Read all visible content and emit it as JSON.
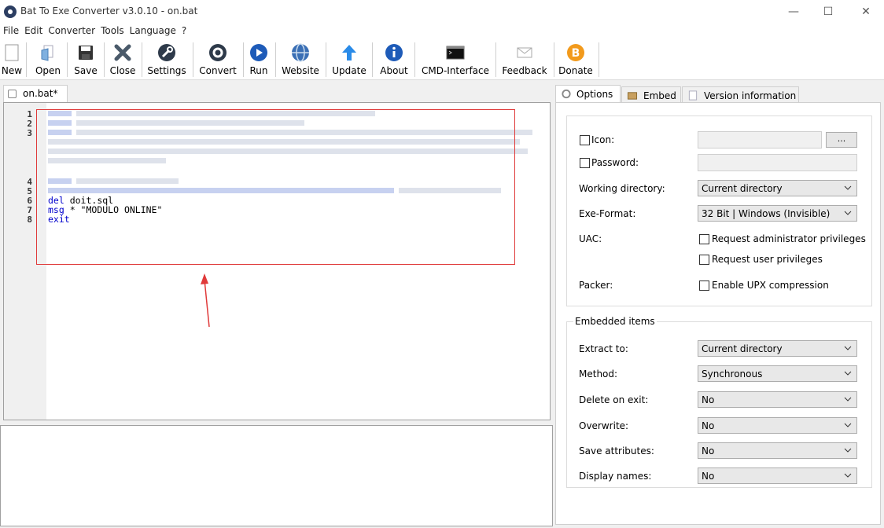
{
  "window": {
    "title": "Bat To Exe Converter v3.0.10 - on.bat",
    "minimize": "—",
    "maximize": "☐",
    "close": "✕"
  },
  "menu": [
    "File",
    "Edit",
    "Converter",
    "Tools",
    "Language",
    "?"
  ],
  "toolbar": [
    {
      "label": "New",
      "icon": "new-file-icon"
    },
    {
      "label": "Open",
      "icon": "open-folder-icon"
    },
    {
      "label": "Save",
      "icon": "floppy-disk-icon"
    },
    {
      "label": "Close",
      "icon": "close-x-icon"
    },
    {
      "label": "Settings",
      "icon": "wrench-icon"
    },
    {
      "label": "Convert",
      "icon": "gear-icon"
    },
    {
      "label": "Run",
      "icon": "play-icon"
    },
    {
      "label": "Website",
      "icon": "globe-icon"
    },
    {
      "label": "Update",
      "icon": "up-arrow-icon"
    },
    {
      "label": "About",
      "icon": "info-icon"
    },
    {
      "label": "CMD-Interface",
      "icon": "console-icon"
    },
    {
      "label": "Feedback",
      "icon": "envelope-icon"
    },
    {
      "label": "Donate",
      "icon": "bitcoin-icon"
    }
  ],
  "editor": {
    "tab_label": "on.bat*",
    "line_numbers": [
      "1",
      "2",
      "3",
      "4",
      "5",
      "6",
      "7",
      "8"
    ],
    "visible_code": {
      "line6_kw": "del",
      "line6_rest": " doit.sql",
      "line7_kw": "msg",
      "line7_rest": " * \"MODULO ONLINE\"",
      "line8_kw": "exit"
    }
  },
  "right_tabs": {
    "options": "Options",
    "embed": "Embed",
    "version": "Version information"
  },
  "options": {
    "icon_label": "Icon:",
    "icon_browse": "...",
    "password_label": "Password:",
    "working_dir_label": "Working directory:",
    "working_dir_value": "Current directory",
    "exe_format_label": "Exe-Format:",
    "exe_format_value": "32 Bit | Windows (Invisible)",
    "uac_label": "UAC:",
    "uac_admin": "Request administrator privileges",
    "uac_user": "Request user privileges",
    "packer_label": "Packer:",
    "upx": "Enable UPX compression"
  },
  "embedded": {
    "group_title": "Embedded items",
    "extract_label": "Extract to:",
    "extract_value": "Current directory",
    "method_label": "Method:",
    "method_value": "Synchronous",
    "delete_label": "Delete on exit:",
    "delete_value": "No",
    "overwrite_label": "Overwrite:",
    "overwrite_value": "No",
    "save_attr_label": "Save attributes:",
    "save_attr_value": "No",
    "display_names_label": "Display names:",
    "display_names_value": "No"
  },
  "colors": {
    "highlight": "#e03a3a",
    "keyword": "#0000cc"
  }
}
